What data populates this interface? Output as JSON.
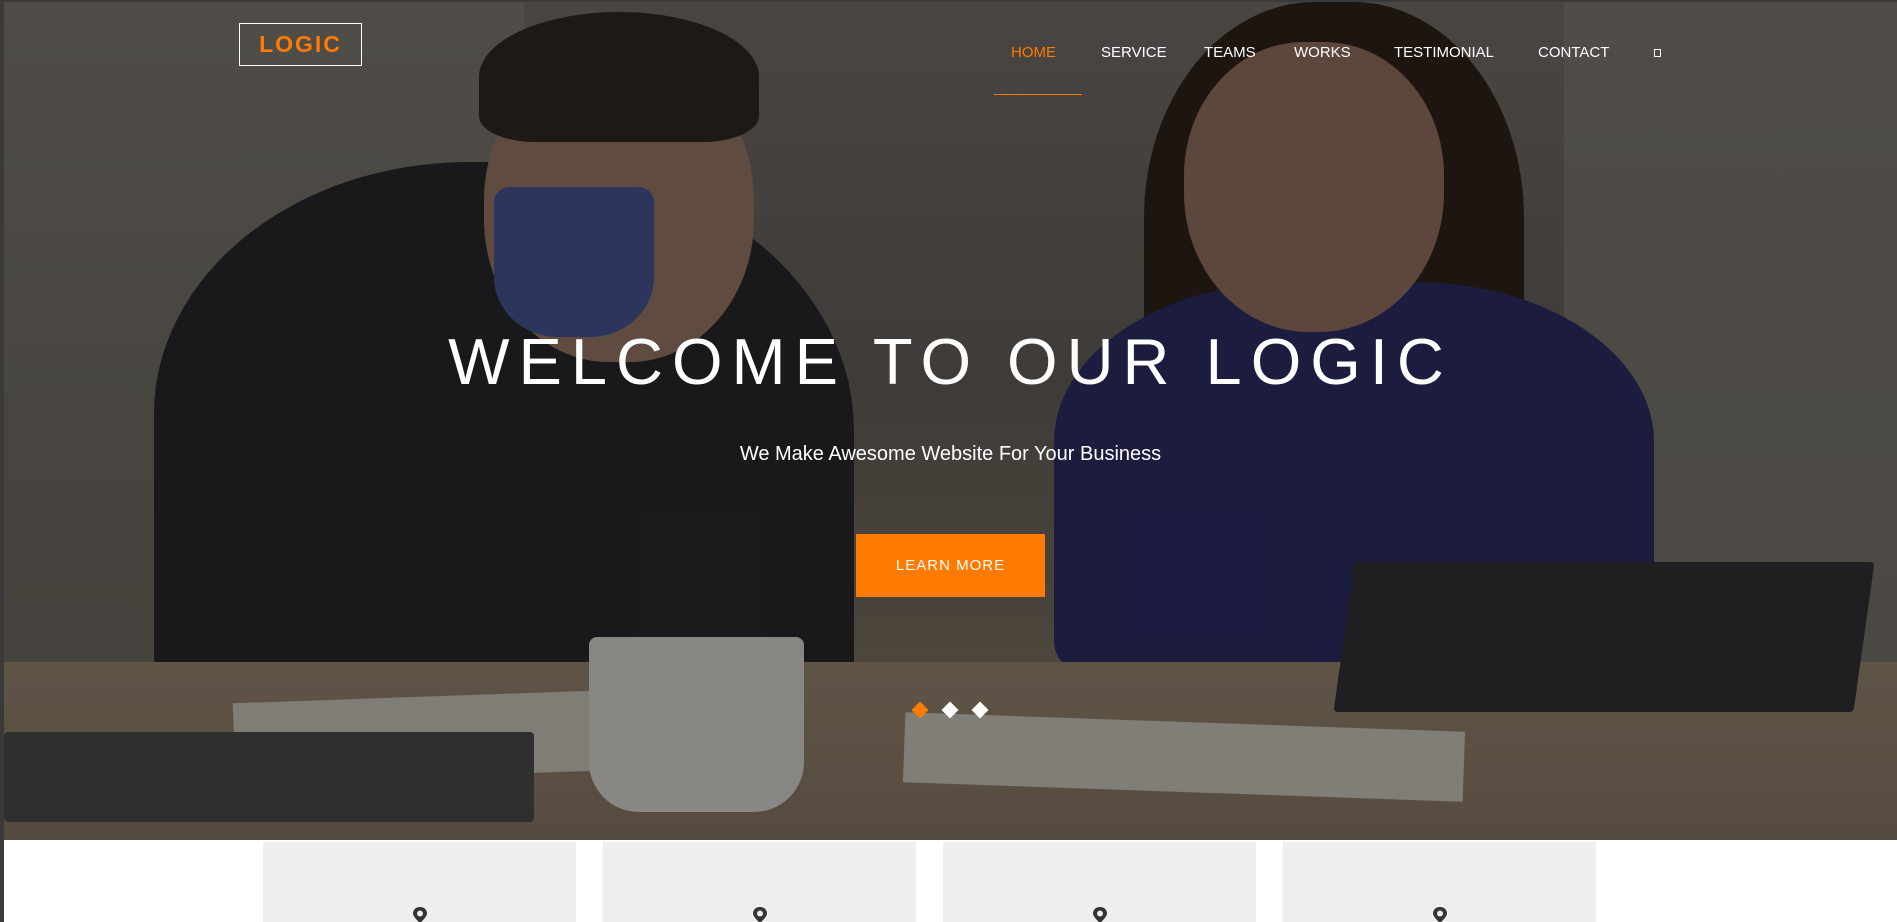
{
  "logo": {
    "text": "LOGIC",
    "accent_color": "#ff7a00"
  },
  "nav": {
    "items": [
      {
        "label": "HOME",
        "active": true
      },
      {
        "label": "SERVICE",
        "active": false
      },
      {
        "label": "TEAMS",
        "active": false
      },
      {
        "label": "WORKS",
        "active": false
      },
      {
        "label": "TESTIMONIAL",
        "active": false
      },
      {
        "label": "CONTACT",
        "active": false
      }
    ],
    "search_icon": "search-icon"
  },
  "hero": {
    "title": "WELCOME TO OUR LOGIC",
    "subtitle": "We Make Awesome Website For Your Business",
    "cta_label": "LEARN MORE",
    "slider": {
      "slide_count": 3,
      "active_index": 0
    }
  },
  "features": {
    "cards": [
      {
        "icon": "map-pin-icon"
      },
      {
        "icon": "map-pin-icon"
      },
      {
        "icon": "map-pin-icon"
      },
      {
        "icon": "map-pin-icon"
      }
    ]
  },
  "colors": {
    "accent": "#ff7a00",
    "text_light": "#ffffff",
    "card_bg": "#eeeeee"
  }
}
